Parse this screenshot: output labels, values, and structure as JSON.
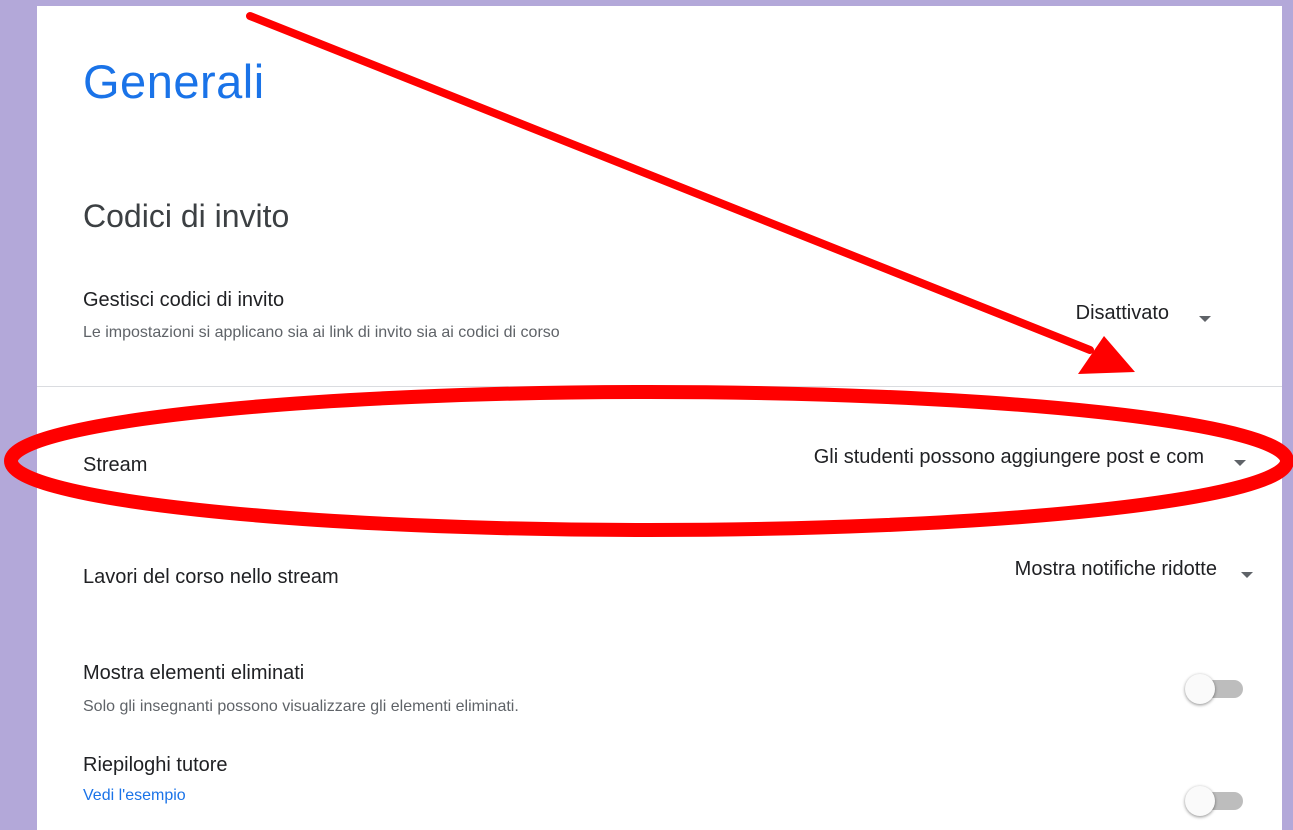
{
  "page": {
    "title": "Generali"
  },
  "invite_codes": {
    "section_title": "Codici di invito",
    "manage": {
      "label": "Gestisci codici di invito",
      "description": "Le impostazioni si applicano sia ai link di invito sia ai codici di corso",
      "value": "Disattivato"
    }
  },
  "stream": {
    "label": "Stream",
    "value": "Gli studenti possono aggiungere post e com"
  },
  "classwork": {
    "label": "Lavori del corso nello stream",
    "value": "Mostra notifiche ridotte"
  },
  "deleted_items": {
    "label": "Mostra elementi eliminati",
    "description": "Solo gli insegnanti possono visualizzare gli elementi eliminati.",
    "enabled": false
  },
  "guardian_summaries": {
    "label": "Riepiloghi tutore",
    "link": "Vedi l'esempio",
    "enabled": false
  },
  "colors": {
    "background": "#b3a8d9",
    "accent": "#1a73e8",
    "annotation": "#ff0000"
  },
  "annotations": {
    "arrow": "arrow-icon",
    "highlight": "ellipse-highlight"
  }
}
